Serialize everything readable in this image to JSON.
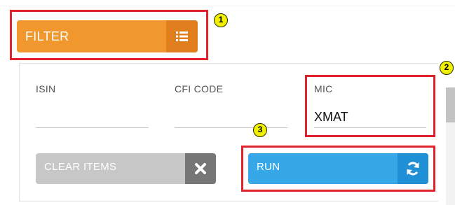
{
  "filter": {
    "label": "FILTER",
    "icon": "list-icon",
    "color": "#f0972e",
    "icon_bg": "#e07d1c"
  },
  "fields": {
    "isin": {
      "label": "ISIN",
      "value": ""
    },
    "cfi_code": {
      "label": "CFI CODE",
      "value": ""
    },
    "mic": {
      "label": "MIC",
      "value": "XMAT"
    }
  },
  "actions": {
    "clear": {
      "label": "CLEAR ITEMS",
      "icon": "close-icon",
      "color": "#c7c7c7",
      "icon_bg": "#767676"
    },
    "run": {
      "label": "RUN",
      "icon": "refresh-icon",
      "color": "#36a8e8",
      "icon_bg": "#1f90d6"
    }
  },
  "annotations": {
    "highlight_color": "#e1222b",
    "badge_color": "#f0f000",
    "badges": [
      "1",
      "2",
      "3"
    ]
  }
}
